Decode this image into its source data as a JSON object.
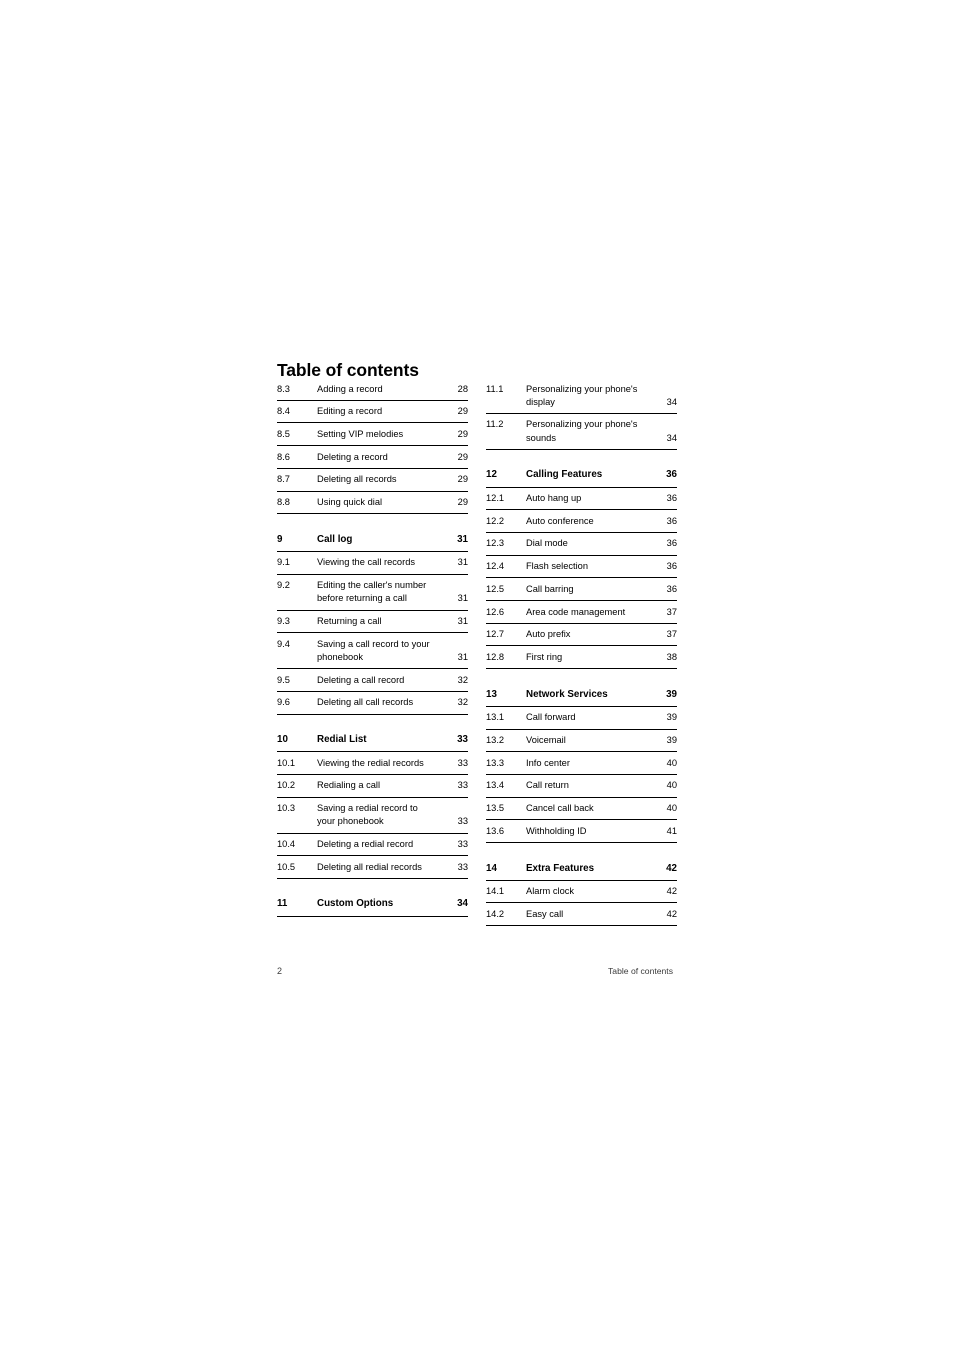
{
  "document": {
    "title": "Table of contents"
  },
  "footer": {
    "page_number": "2",
    "section_title": "Table of contents"
  },
  "toc": {
    "left_column": [
      {
        "number": "8.3",
        "label": "Adding a record",
        "page": "28",
        "section": false,
        "gap_before": false
      },
      {
        "number": "8.4",
        "label": "Editing a record",
        "page": "29",
        "section": false,
        "gap_before": false
      },
      {
        "number": "8.5",
        "label": "Setting VIP melodies",
        "page": "29",
        "section": false,
        "gap_before": false
      },
      {
        "number": "8.6",
        "label": "Deleting a record",
        "page": "29",
        "section": false,
        "gap_before": false
      },
      {
        "number": "8.7",
        "label": "Deleting all records",
        "page": "29",
        "section": false,
        "gap_before": false
      },
      {
        "number": "8.8",
        "label": "Using quick dial",
        "page": "29",
        "section": false,
        "gap_before": false
      },
      {
        "number": "9",
        "label": "Call log",
        "page": "31",
        "section": true,
        "gap_before": true
      },
      {
        "number": "9.1",
        "label": "Viewing the call records",
        "page": "31",
        "section": false,
        "gap_before": false
      },
      {
        "number": "9.2",
        "label": "Editing the caller's number\nbefore returning a call",
        "page": "31",
        "section": false,
        "gap_before": false
      },
      {
        "number": "9.3",
        "label": "Returning a call",
        "page": "31",
        "section": false,
        "gap_before": false
      },
      {
        "number": "9.4",
        "label": "Saving a call record to your\nphonebook",
        "page": "31",
        "section": false,
        "gap_before": false
      },
      {
        "number": "9.5",
        "label": "Deleting a call record",
        "page": "32",
        "section": false,
        "gap_before": false
      },
      {
        "number": "9.6",
        "label": "Deleting all call records",
        "page": "32",
        "section": false,
        "gap_before": false
      },
      {
        "number": "10",
        "label": "Redial List",
        "page": "33",
        "section": true,
        "gap_before": true
      },
      {
        "number": "10.1",
        "label": "Viewing the redial records",
        "page": "33",
        "section": false,
        "gap_before": false
      },
      {
        "number": "10.2",
        "label": "Redialing a call",
        "page": "33",
        "section": false,
        "gap_before": false
      },
      {
        "number": "10.3",
        "label": "Saving a redial record to\nyour phonebook",
        "page": "33",
        "section": false,
        "gap_before": false
      },
      {
        "number": "10.4",
        "label": "Deleting a redial record",
        "page": "33",
        "section": false,
        "gap_before": false
      },
      {
        "number": "10.5",
        "label": "Deleting all redial records",
        "page": "33",
        "section": false,
        "gap_before": false
      },
      {
        "number": "11",
        "label": "Custom Options",
        "page": "34",
        "section": true,
        "gap_before": true
      }
    ],
    "right_column": [
      {
        "number": "11.1",
        "label": "Personalizing your phone's\ndisplay",
        "page": "34",
        "section": false,
        "gap_before": false
      },
      {
        "number": "11.2",
        "label": "Personalizing your phone's\nsounds",
        "page": "34",
        "section": false,
        "gap_before": false
      },
      {
        "number": "12",
        "label": "Calling Features",
        "page": "36",
        "section": true,
        "gap_before": true
      },
      {
        "number": "12.1",
        "label": "Auto hang up",
        "page": "36",
        "section": false,
        "gap_before": false
      },
      {
        "number": "12.2",
        "label": "Auto conference",
        "page": "36",
        "section": false,
        "gap_before": false
      },
      {
        "number": "12.3",
        "label": "Dial mode",
        "page": "36",
        "section": false,
        "gap_before": false
      },
      {
        "number": "12.4",
        "label": "Flash selection",
        "page": "36",
        "section": false,
        "gap_before": false
      },
      {
        "number": "12.5",
        "label": "Call barring",
        "page": "36",
        "section": false,
        "gap_before": false
      },
      {
        "number": "12.6",
        "label": "Area code management",
        "page": "37",
        "section": false,
        "gap_before": false
      },
      {
        "number": "12.7",
        "label": "Auto prefix",
        "page": "37",
        "section": false,
        "gap_before": false
      },
      {
        "number": "12.8",
        "label": "First ring",
        "page": "38",
        "section": false,
        "gap_before": false
      },
      {
        "number": "13",
        "label": "Network Services",
        "page": "39",
        "section": true,
        "gap_before": true
      },
      {
        "number": "13.1",
        "label": "Call forward",
        "page": "39",
        "section": false,
        "gap_before": false
      },
      {
        "number": "13.2",
        "label": "Voicemail",
        "page": "39",
        "section": false,
        "gap_before": false
      },
      {
        "number": "13.3",
        "label": "Info center",
        "page": "40",
        "section": false,
        "gap_before": false
      },
      {
        "number": "13.4",
        "label": "Call return",
        "page": "40",
        "section": false,
        "gap_before": false
      },
      {
        "number": "13.5",
        "label": "Cancel call back",
        "page": "40",
        "section": false,
        "gap_before": false
      },
      {
        "number": "13.6",
        "label": "Withholding ID",
        "page": "41",
        "section": false,
        "gap_before": false
      },
      {
        "number": "14",
        "label": "Extra Features",
        "page": "42",
        "section": true,
        "gap_before": true
      },
      {
        "number": "14.1",
        "label": "Alarm clock",
        "page": "42",
        "section": false,
        "gap_before": false
      },
      {
        "number": "14.2",
        "label": "Easy call",
        "page": "42",
        "section": false,
        "gap_before": false
      }
    ]
  }
}
